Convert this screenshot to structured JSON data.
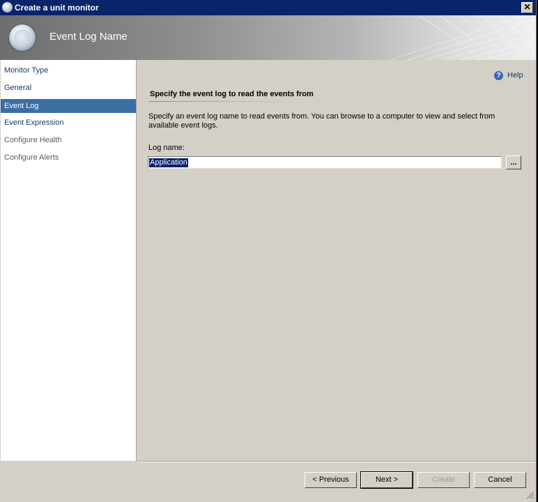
{
  "window": {
    "title": "Create a unit monitor",
    "close_label": "✕"
  },
  "banner": {
    "title": "Event Log Name"
  },
  "sidebar": {
    "items": [
      {
        "label": "Monitor Type",
        "state": "done"
      },
      {
        "label": "General",
        "state": "done"
      },
      {
        "label": "Event Log",
        "state": "active"
      },
      {
        "label": "Event Expression",
        "state": "done"
      },
      {
        "label": "Configure Health",
        "state": "pending"
      },
      {
        "label": "Configure Alerts",
        "state": "pending"
      }
    ]
  },
  "content": {
    "help_label": "Help",
    "help_icon": "?",
    "heading": "Specify the event log to read the events from",
    "description": "Specify an event log name to read events from. You can browse to a computer to view and select from available event logs.",
    "log_name_label": "Log name:",
    "log_name_value": "Application",
    "browse_label": "..."
  },
  "footer": {
    "previous_label": "< Previous",
    "next_label": "Next >",
    "create_label": "Create",
    "cancel_label": "Cancel"
  },
  "colors": {
    "titlebar": "#0a246a",
    "active_nav": "#3a6ea5",
    "dialog_bg": "#d4d0c8"
  }
}
